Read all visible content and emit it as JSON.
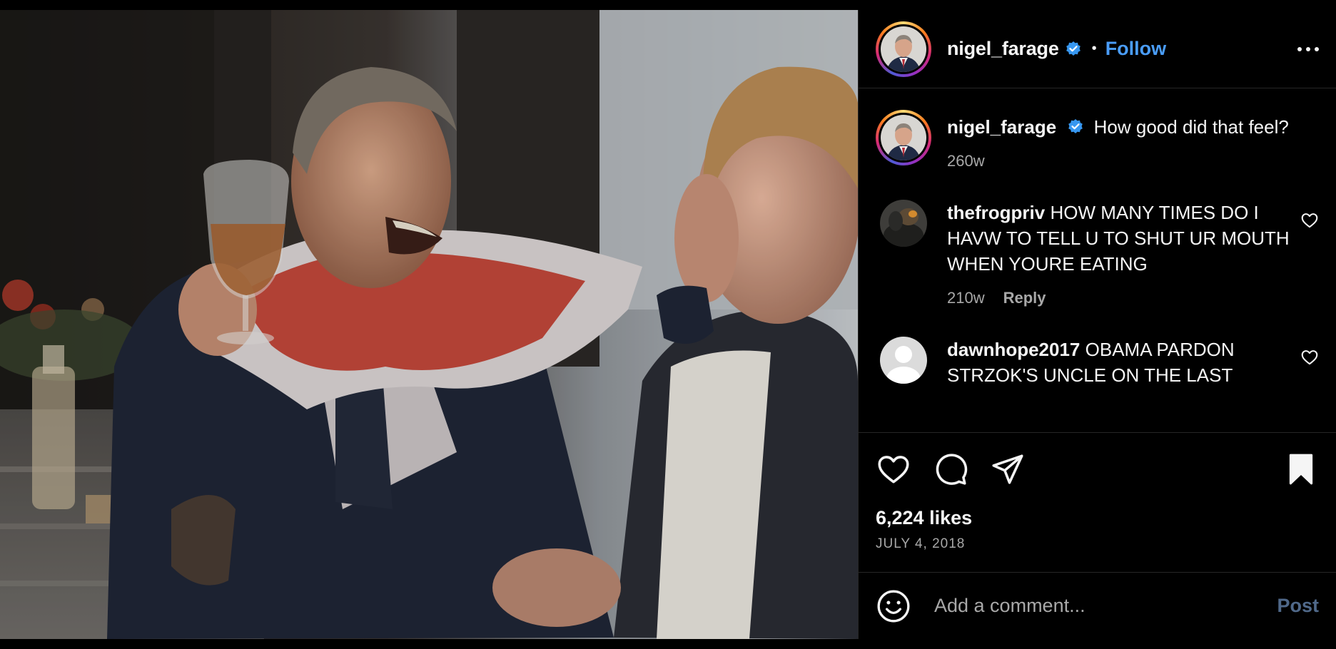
{
  "author": {
    "username": "nigel_farage",
    "follow_label": "Follow",
    "dot": "•"
  },
  "caption": {
    "username": "nigel_farage",
    "text": "How good did that feel?",
    "time": "260w"
  },
  "comments": [
    {
      "username": "thefrogpriv",
      "text": "HOW MANY TIMES DO I HAVW TO TELL U TO SHUT UR MOUTH WHEN YOURE EATING",
      "time": "210w",
      "reply_label": "Reply"
    },
    {
      "username": "dawnhope2017",
      "text": "OBAMA PARDON STRZOK'S UNCLE ON THE LAST"
    }
  ],
  "stats": {
    "likes": "6,224 likes",
    "date": "JULY 4, 2018"
  },
  "composer": {
    "placeholder": "Add a comment...",
    "post_label": "Post"
  },
  "icons": {
    "more": "more-options-icon",
    "verified": "verified-badge-icon",
    "like": "heart-icon",
    "comment": "comment-icon",
    "share": "share-icon",
    "save": "bookmark-icon",
    "emoji": "emoji-icon"
  },
  "colors": {
    "background": "#000000",
    "link_blue": "#4a9df8",
    "verified_blue": "#3797f0",
    "secondary_text": "#a8a8a8",
    "divider": "#262626"
  }
}
